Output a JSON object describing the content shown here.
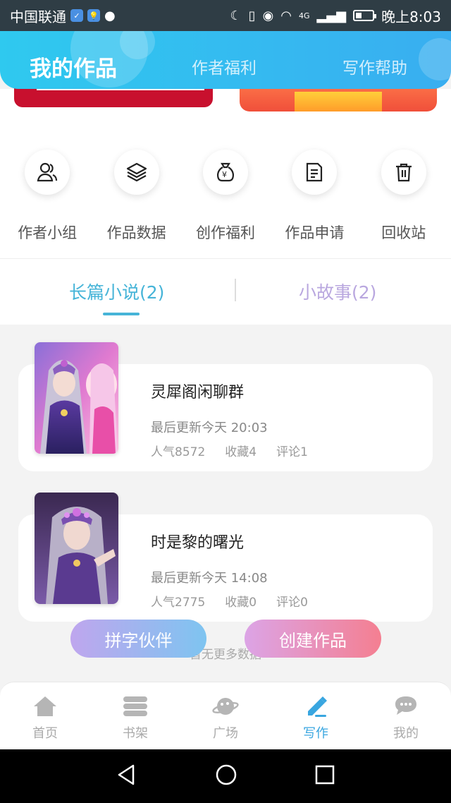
{
  "status_bar": {
    "carrier": "中国联通",
    "time": "晚上8:03",
    "network": "4G",
    "battery_level": 0.35
  },
  "header": {
    "tabs": [
      {
        "label": "我的作品",
        "active": true
      },
      {
        "label": "作者福利",
        "active": false
      },
      {
        "label": "写作帮助",
        "active": false
      }
    ]
  },
  "quick_actions": [
    {
      "label": "作者小组",
      "icon": "author-group-icon"
    },
    {
      "label": "作品数据",
      "icon": "layers-icon"
    },
    {
      "label": "创作福利",
      "icon": "money-bag-icon"
    },
    {
      "label": "作品申请",
      "icon": "document-icon"
    },
    {
      "label": "回收站",
      "icon": "trash-icon"
    }
  ],
  "segments": [
    {
      "label": "长篇小说(2)",
      "active": true
    },
    {
      "label": "小故事(2)",
      "active": false
    }
  ],
  "books": [
    {
      "title": "灵犀阁闲聊群",
      "updated": "最后更新今天 20:03",
      "popularity": "人气8572",
      "favorites": "收藏4",
      "comments": "评论1"
    },
    {
      "title": "时是黎的曙光",
      "updated": "最后更新今天 14:08",
      "popularity": "人气2775",
      "favorites": "收藏0",
      "comments": "评论0"
    }
  ],
  "no_more_text": "暂无更多数据",
  "buttons": {
    "partner": "拼字伙伴",
    "create": "创建作品"
  },
  "bottom_nav": [
    {
      "label": "首页",
      "icon": "home-icon",
      "active": false
    },
    {
      "label": "书架",
      "icon": "bookshelf-icon",
      "active": false
    },
    {
      "label": "广场",
      "icon": "planet-icon",
      "active": false
    },
    {
      "label": "写作",
      "icon": "pen-icon",
      "active": true
    },
    {
      "label": "我的",
      "icon": "chat-icon",
      "active": false
    }
  ],
  "colors": {
    "accent": "#39a6e0",
    "header_gradient_start": "#2fc9ef",
    "header_gradient_end": "#39aef0",
    "secondary_tab": "#b9a7df"
  }
}
